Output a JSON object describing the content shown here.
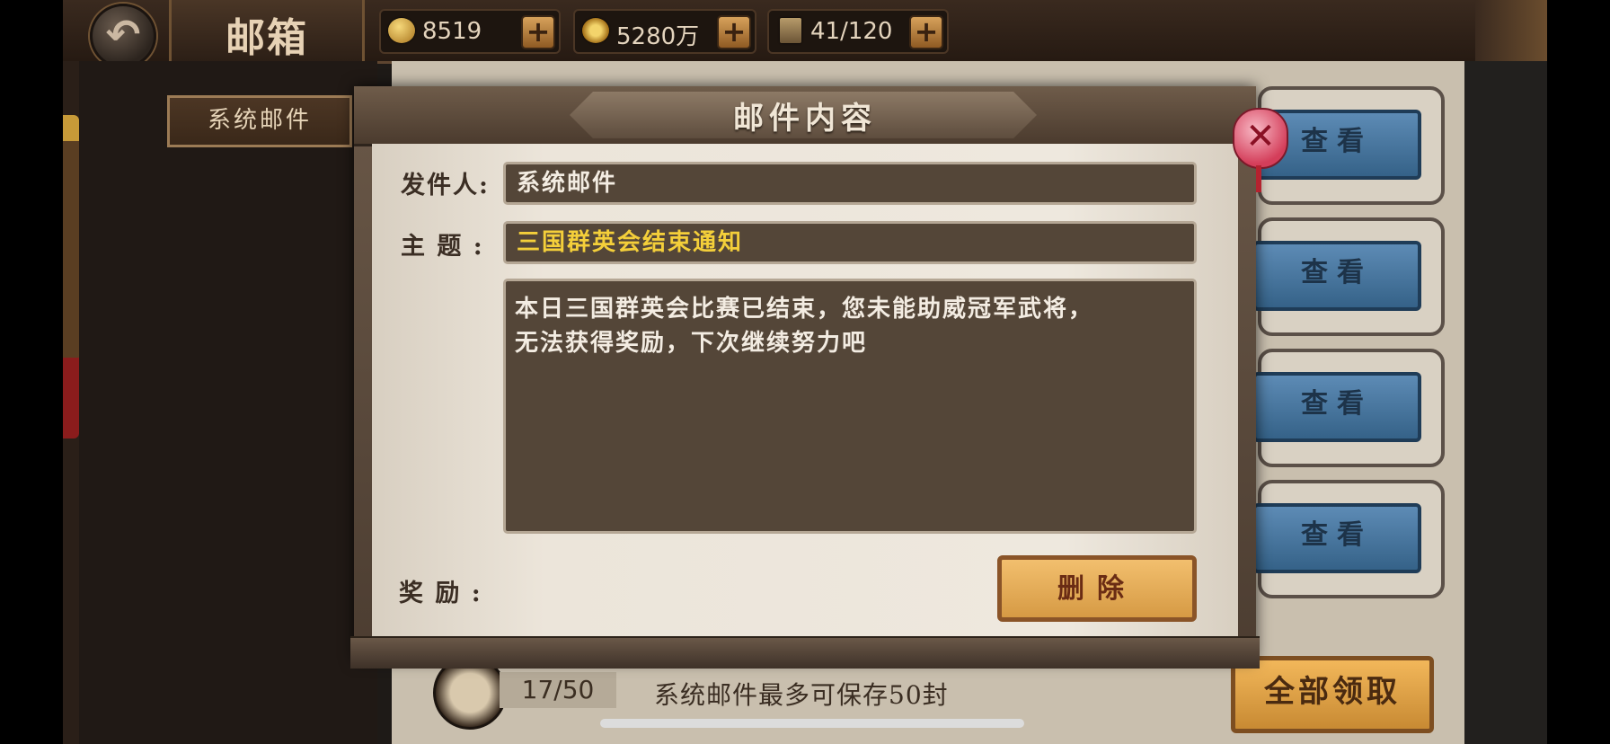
{
  "topbar": {
    "title": "邮箱",
    "back_icon": "back-arrow-icon",
    "resources": [
      {
        "icon": "gold-ingot-icon",
        "value": "8519"
      },
      {
        "icon": "copper-coin-icon",
        "value": "5280万"
      },
      {
        "icon": "troop-tower-icon",
        "value": "41/120"
      }
    ]
  },
  "sidebar": {
    "tab_label": "系统邮件"
  },
  "mail_list": {
    "view_label": "查看",
    "count": "17/50",
    "storage_note": "系统邮件最多可保存50封",
    "claim_all_label": "全部领取"
  },
  "dialog": {
    "title": "邮件内容",
    "sender_label": "发件人:",
    "sender_value": "系统邮件",
    "subject_label": "主 题 :",
    "subject_value": "三国群英会结束通知",
    "body_line1": "本日三国群英会比赛已结束，您未能助威冠军武将，",
    "body_line2": "无法获得奖励，下次继续努力吧",
    "reward_label": "奖 励 :",
    "delete_label": "删除",
    "close_symbol": "✕"
  },
  "colors": {
    "subject_text": "#f4cf3a",
    "view_button": "#4a78a4",
    "action_button": "#e6a955"
  }
}
